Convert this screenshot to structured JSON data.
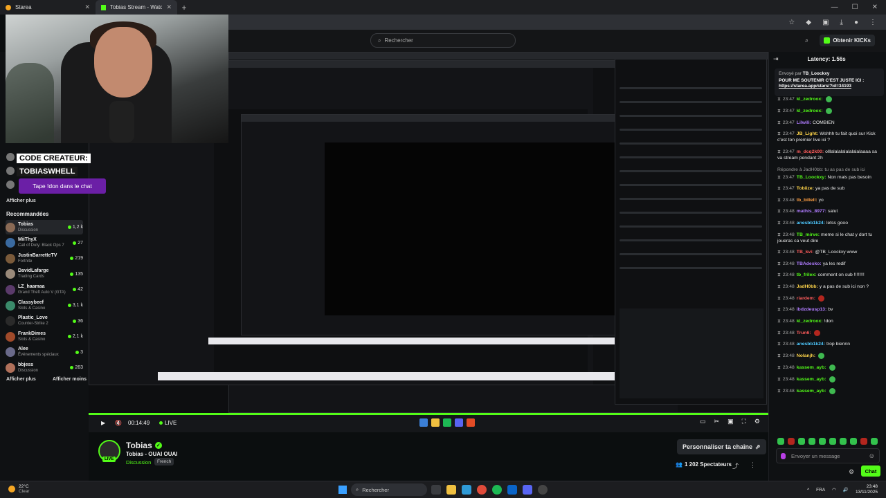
{
  "browser": {
    "tabs": [
      {
        "title": "Starea",
        "active": false
      },
      {
        "title": "Tobias Stream - Watch Live on",
        "active": true
      }
    ]
  },
  "header": {
    "search_placeholder": "Rechercher",
    "kicks_label": "Obtenir KICKs"
  },
  "overlay": {
    "code_label": "CODE CREATEUR:",
    "code_value": "TOBIASWHELL",
    "tape_text": "Tape !don dans le chat"
  },
  "sidebar": {
    "show_more": "Afficher plus",
    "recommended_title": "Recommandées",
    "show_more_bottom": "Afficher plus",
    "show_less": "Afficher moins",
    "channels": [
      {
        "name": "Tobias",
        "category": "Discussion",
        "viewers": "1,2 k",
        "color": "#8a6a55"
      },
      {
        "name": "MiiThyX",
        "category": "Call of Duty: Black Ops 7",
        "viewers": "27",
        "color": "#3a6aa0"
      },
      {
        "name": "JustinBarretteTV",
        "category": "Fortnite",
        "viewers": "219",
        "color": "#7a5a3a"
      },
      {
        "name": "DavidLafarge",
        "category": "Trading Cards",
        "viewers": "135",
        "color": "#9a8a7a"
      },
      {
        "name": "LZ_haamaa",
        "category": "Grand Theft Auto V (GTA)",
        "viewers": "42",
        "color": "#5a3a6a"
      },
      {
        "name": "Classybeef",
        "category": "Slots & Casino",
        "viewers": "3,1 k",
        "color": "#3a8a6a"
      },
      {
        "name": "Plastic_Love",
        "category": "Counter-Strike 2",
        "viewers": "36",
        "color": "#2a2a2a"
      },
      {
        "name": "FrankDimes",
        "category": "Slots & Casino",
        "viewers": "2,1 k",
        "color": "#a04a2a"
      },
      {
        "name": "Alee",
        "category": "Événements spéciaux",
        "viewers": "3",
        "color": "#6a6a8a"
      },
      {
        "name": "bbjess",
        "category": "Discussion",
        "viewers": "263",
        "color": "#b0705a"
      }
    ]
  },
  "player": {
    "time": "00:14:49",
    "live_label": "LIVE"
  },
  "stream_info": {
    "channel_name": "Tobias",
    "title": "Tobias - OUAI OUAI",
    "category": "Discussion",
    "language": "French",
    "live_badge": "LIVE",
    "personalize_label": "Personnaliser ta chaîne",
    "viewers_label": "1 202 Spectateurs"
  },
  "chat": {
    "latency": "Latency: 1.56s",
    "pinned_by_prefix": "Envoyé par",
    "pinned_by_user": "TB_Loockxy",
    "pinned_message": "POUR ME SOUTENIR C'EST JUSTE ICI :",
    "pinned_url": "https://starea.app/stars/?id=34193",
    "messages": [
      {
        "time": "23:47",
        "user": "kl_zedroox:",
        "color": "#53fc18",
        "text": "",
        "emote": true
      },
      {
        "time": "23:47",
        "user": "kl_zedroox:",
        "color": "#53fc18",
        "text": "",
        "emote": true
      },
      {
        "time": "23:47",
        "user": "Lilwili:",
        "color": "#b07cff",
        "text": "COMBIEN"
      },
      {
        "time": "23:47",
        "user": "JB_Light:",
        "color": "#ffd54a",
        "text": "Wshhh tu fait quoi sur Kick c'est ton premier live ici ?"
      },
      {
        "time": "23:47",
        "user": "m_dcq2k00:",
        "color": "#ff5c5c",
        "text": "olllalalalalalalalalaaaa sa va stream pendant 2h"
      },
      {
        "time": "23:47",
        "user": "TB_Loockxy:",
        "color": "#53fc18",
        "text": "Non mais pas besoin",
        "reply": "Répondre à JadH0bb: tu as pas de sub ici"
      },
      {
        "time": "23:47",
        "user": "Tobiize:",
        "color": "#ffd54a",
        "text": "ya pas de sub"
      },
      {
        "time": "23:48",
        "user": "tb_billell:",
        "color": "#ff9f43",
        "text": "yo"
      },
      {
        "time": "23:48",
        "user": "mathis_8977:",
        "color": "#b07cff",
        "text": "salut"
      },
      {
        "time": "23:48",
        "user": "anesbb1k24:",
        "color": "#4ec9ff",
        "text": "letss gooo"
      },
      {
        "time": "23:48",
        "user": "TB_mirve:",
        "color": "#53fc18",
        "text": "meme si le chat y dort tu joueras ca veut dire"
      },
      {
        "time": "23:48",
        "user": "TB_kvi:",
        "color": "#ff5c5c",
        "text": "@TB_Loockxy www"
      },
      {
        "time": "23:48",
        "user": "TBAdesko:",
        "color": "#b07cff",
        "text": "ya les redif"
      },
      {
        "time": "23:48",
        "user": "tb_frilex:",
        "color": "#53fc18",
        "text": "comment on sub !!!!!!!!"
      },
      {
        "time": "23:48",
        "user": "JadH0bb:",
        "color": "#ffd54a",
        "text": "y a pas de sub ici non ?"
      },
      {
        "time": "23:48",
        "user": "riardem:",
        "color": "#ff5c5c",
        "text": "",
        "emote": true
      },
      {
        "time": "23:48",
        "user": "ibdzdeusp13:",
        "color": "#b07cff",
        "text": "bv"
      },
      {
        "time": "23:48",
        "user": "kl_zedroox:",
        "color": "#53fc18",
        "text": "!don"
      },
      {
        "time": "23:48",
        "user": "Trun6:",
        "color": "#ff5c5c",
        "text": "",
        "emote": true
      },
      {
        "time": "23:48",
        "user": "anesbb1k24:",
        "color": "#4ec9ff",
        "text": "trop biennn"
      },
      {
        "time": "23:48",
        "user": "Nolanjh:",
        "color": "#ffd54a",
        "text": "",
        "emote": true
      },
      {
        "time": "23:48",
        "user": "kassem_ayb:",
        "color": "#53fc18",
        "text": "",
        "emote": true
      },
      {
        "time": "23:48",
        "user": "kassem_ayb:",
        "color": "#53fc18",
        "text": "",
        "emote": true
      },
      {
        "time": "23:48",
        "user": "kassem_ayb:",
        "color": "#53fc18",
        "text": "",
        "emote": true
      }
    ],
    "input_placeholder": "Envoyer un message",
    "send_label": "Chat"
  },
  "taskbar": {
    "temperature": "22°C",
    "weather": "Clear",
    "search_label": "Rechercher",
    "language": "FRA",
    "time": "23:48",
    "date": "13/11/2025"
  },
  "colors": {
    "accent": "#53fc18",
    "purple": "#6b1fa6"
  }
}
